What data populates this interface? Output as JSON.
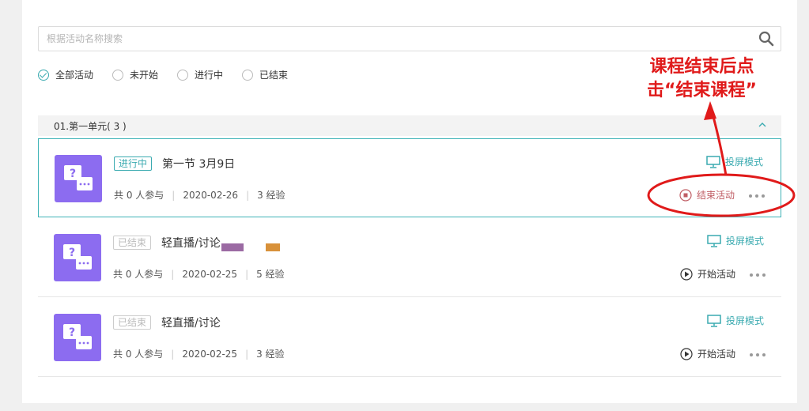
{
  "search": {
    "placeholder": "根据活动名称搜索",
    "icon": "search-icon"
  },
  "filters": [
    {
      "label": "全部活动",
      "checked": true
    },
    {
      "label": "未开始",
      "checked": false
    },
    {
      "label": "进行中",
      "checked": false
    },
    {
      "label": "已结束",
      "checked": false
    }
  ],
  "unit": {
    "title": "01.第一单元( 3 )"
  },
  "cards": [
    {
      "status": "进行中",
      "title": "第一节 3月9日",
      "participants": "共 0 人参与",
      "date": "2020-02-26",
      "exp": "3 经验",
      "projection": "投屏模式",
      "action": "结束活动",
      "action_icon": "stop-icon"
    },
    {
      "status": "已结束",
      "title": "轻直播/讨论",
      "participants": "共 0 人参与",
      "date": "2020-02-25",
      "exp": "5 经验",
      "projection": "投屏模式",
      "action": "开始活动",
      "action_icon": "play-icon"
    },
    {
      "status": "已结束",
      "title": "轻直播/讨论",
      "participants": "共 0 人参与",
      "date": "2020-02-25",
      "exp": "3 经验",
      "projection": "投屏模式",
      "action": "开始活动",
      "action_icon": "play-icon"
    }
  ],
  "annotation": {
    "line1": "课程结束后点",
    "line2": "击“结束课程”",
    "color": "#e01a1a"
  },
  "colors": {
    "accent": "#3aaab0",
    "thumb": "#8c6cf0",
    "stop": "#c05d64"
  }
}
